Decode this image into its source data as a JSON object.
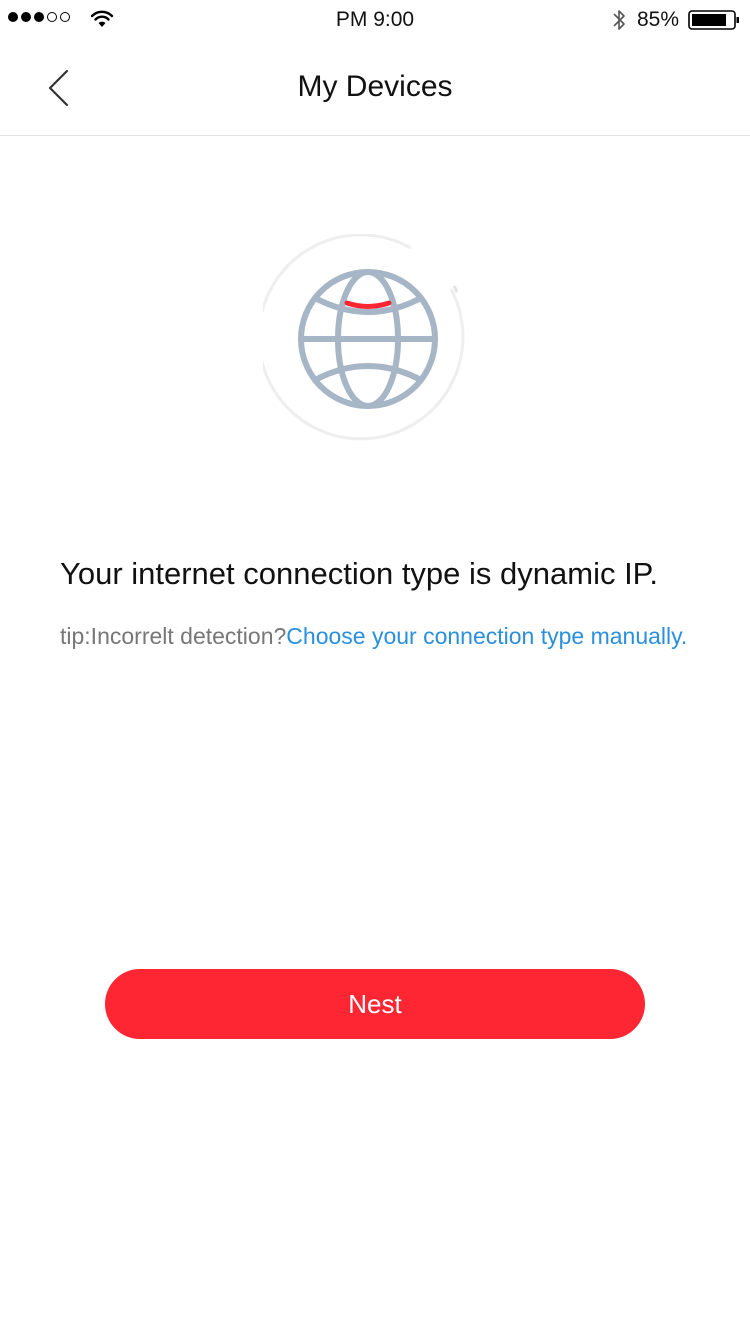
{
  "status_bar": {
    "time": "PM  9:00",
    "battery_percent": "85%",
    "signal_bars_filled": 3,
    "signal_bars_total": 5
  },
  "nav": {
    "title": "My Devices"
  },
  "illustration": {
    "icon": "globe-icon",
    "accent_color": "#ff2633",
    "globe_color": "#a6b6c6"
  },
  "message": {
    "text": "Your internet connection type is dynamic IP.",
    "tip_prefix": "tip:Incorrelt detection?",
    "tip_link": "Choose your connection type manually."
  },
  "actions": {
    "primary_label": "Nest",
    "primary_color": "#ff2633"
  }
}
